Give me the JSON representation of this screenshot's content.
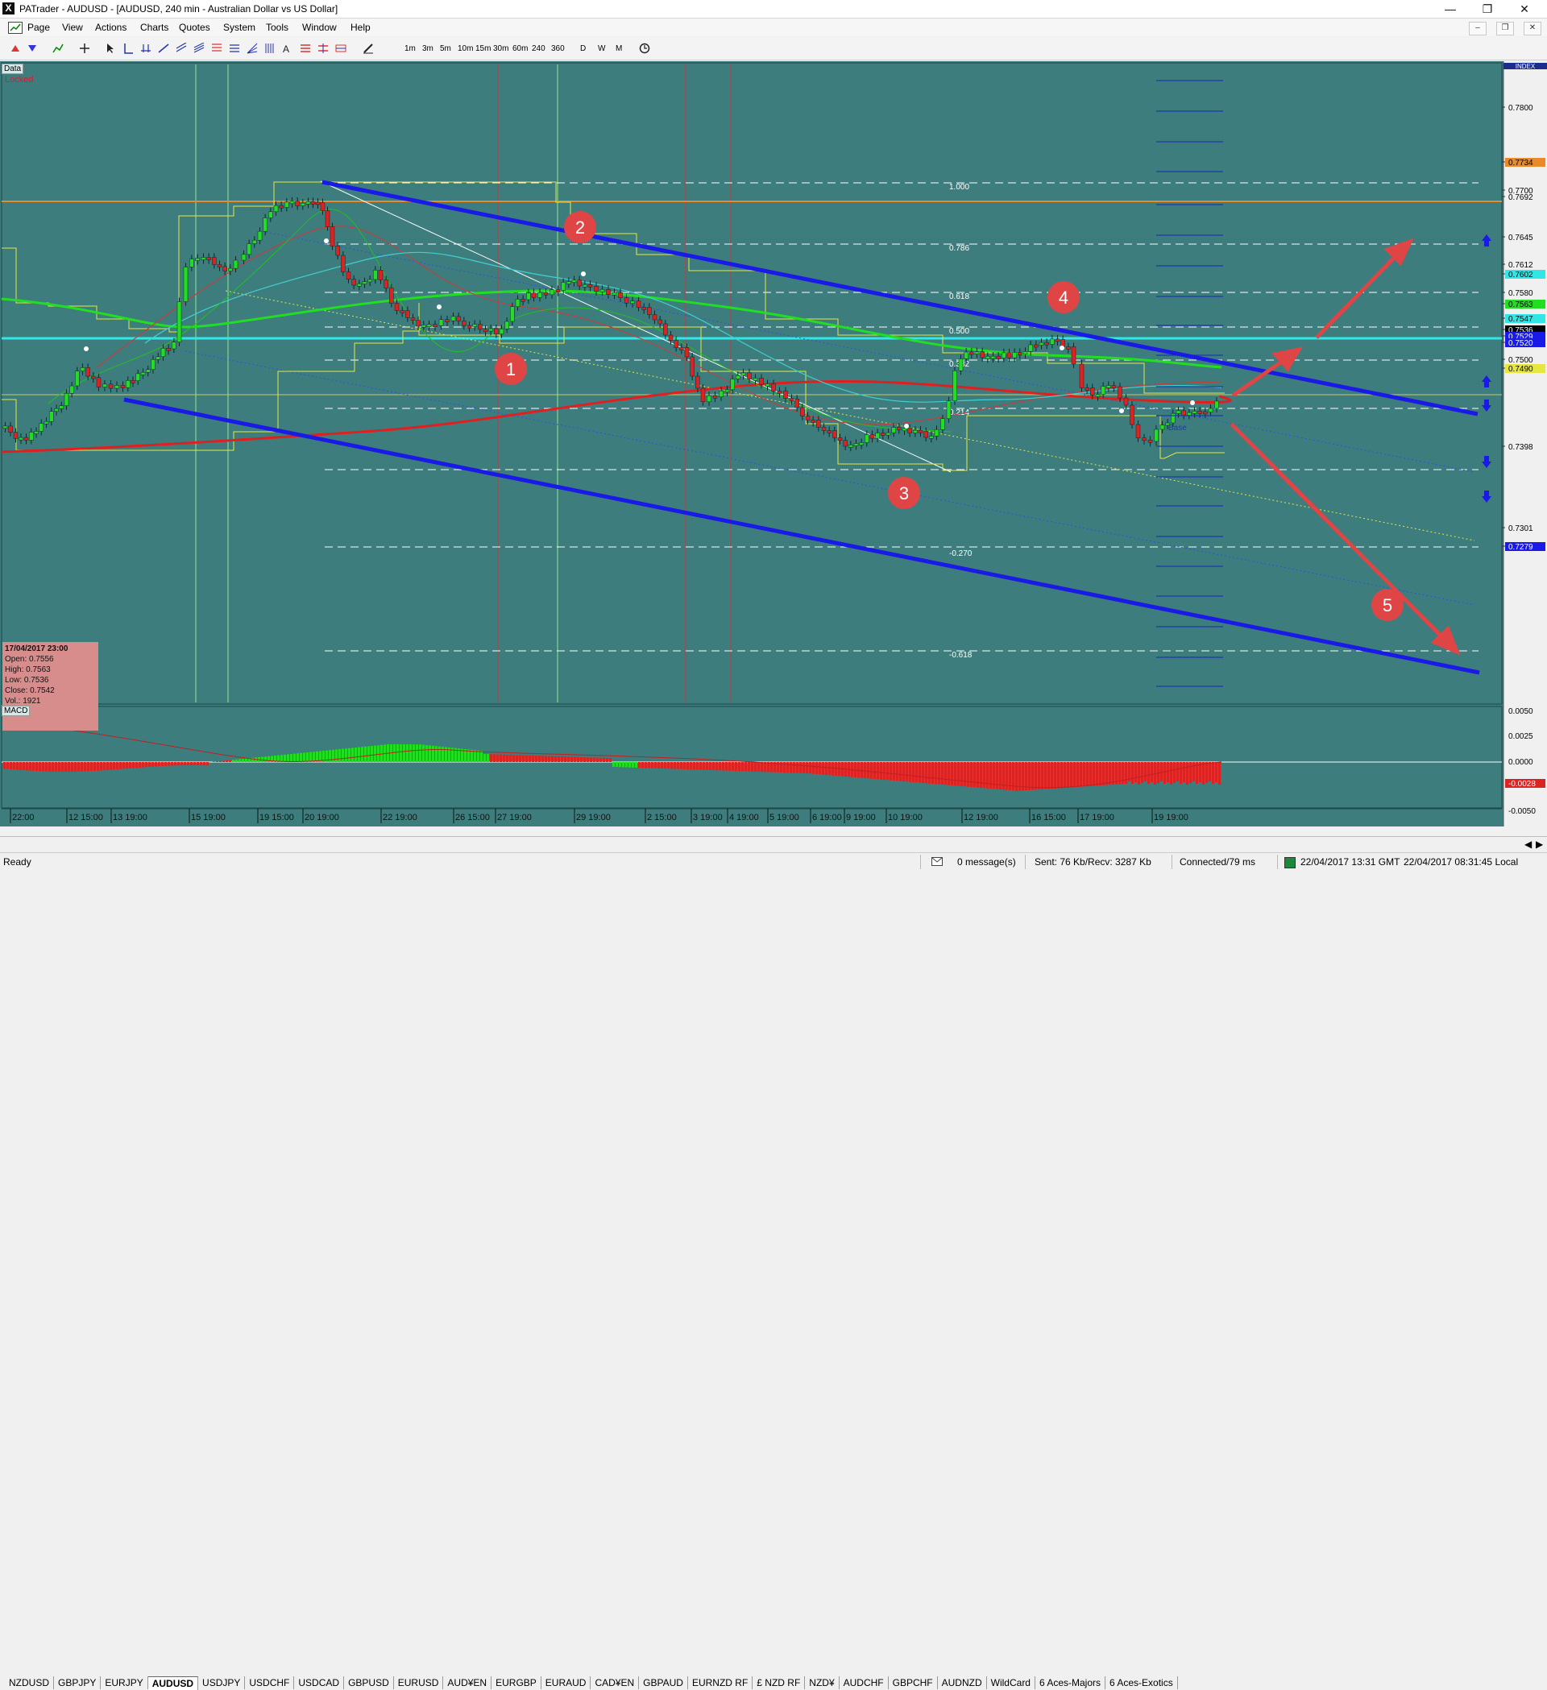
{
  "window": {
    "title": "PATrader - AUDUSD - [AUDUSD, 240 min - Australian Dollar vs US Dollar]"
  },
  "menu": [
    "Page",
    "View",
    "Actions",
    "Charts",
    "Quotes",
    "System",
    "Tools",
    "Window",
    "Help"
  ],
  "toolbar": {
    "timeframes": [
      "1m",
      "3m",
      "5m",
      "10m",
      "15m",
      "30m",
      "60m",
      "240",
      "360",
      "D",
      "W",
      "M"
    ]
  },
  "chart": {
    "data_label": "Data",
    "locked_label": "Locked",
    "index_label": "INDEX",
    "price_labels": [
      "0.7800",
      "0.7734",
      "0.7700",
      "0.7692",
      "0.7645",
      "0.7612",
      "0.7602",
      "0.7580",
      "0.7563",
      "0.7547",
      "0.7536",
      "0.7529",
      "0.7520",
      "0.7500",
      "0.7490",
      "0.7398",
      "0.7301",
      "0.7279"
    ],
    "fib_labels": [
      "1.000",
      "0.786",
      "0.618",
      "0.500",
      "0.382",
      "0.214",
      "-0.270",
      "-0.618"
    ],
    "date_labels": [
      "22:00",
      "12 15:00",
      "13 19:00",
      "15 19:00",
      "19 15:00",
      "20 19:00",
      "22 19:00",
      "26 15:00",
      "27 19:00",
      "29 19:00",
      "2 15:00",
      "3 19:00",
      "4 19:00",
      "5 19:00",
      "6 19:00",
      "9 19:00",
      "10 19:00",
      "12 19:00",
      "16 15:00",
      "17 19:00",
      "19 19:00"
    ],
    "markers": [
      "1",
      "2",
      "3",
      "4",
      "5"
    ],
    "base_label": "Base",
    "ohlc": {
      "date": "17/04/2017 23:00",
      "open": "Open: 0.7556",
      "high": "High: 0.7563",
      "low": "Low: 0.7536",
      "close": "Close: 0.7542",
      "vol": "Vol.: 1921"
    }
  },
  "macd": {
    "label": "MACD",
    "price_labels": [
      "0.0050",
      "0.0025",
      "0.0000",
      "-0.0028",
      "-0.0050"
    ]
  },
  "symbol_tabs": [
    "NZDUSD",
    "GBPJPY",
    "EURJPY",
    "AUDUSD",
    "USDJPY",
    "USDCHF",
    "USDCAD",
    "GBPUSD",
    "EURUSD",
    "AUD¥EN",
    "EURGBP",
    "EURAUD",
    "CAD¥EN",
    "GBPAUD",
    "EURNZD RF",
    "£ NZD RF",
    "NZD¥",
    "AUDCHF",
    "GBPCHF",
    "AUDNZD",
    "WildCard",
    "6 Aces-Majors",
    "6 Aces-Exotics"
  ],
  "active_tab": "AUDUSD",
  "status": {
    "ready": "Ready",
    "messages": "0 message(s)",
    "traffic": "Sent: 76 Kb/Recv: 3287 Kb",
    "connection": "Connected/79 ms",
    "gmt_time": "22/04/2017 13:31 GMT",
    "local_time": "22/04/2017 08:31:45 Local"
  },
  "colors": {
    "chart_bg": "#3e7d7d",
    "bull": "#22dd22",
    "bear": "#dd2222",
    "channel": "#1a1ae6",
    "arrow": "#e04545",
    "cyan_line": "#33e6e6",
    "orange_line": "#e88a2a"
  }
}
